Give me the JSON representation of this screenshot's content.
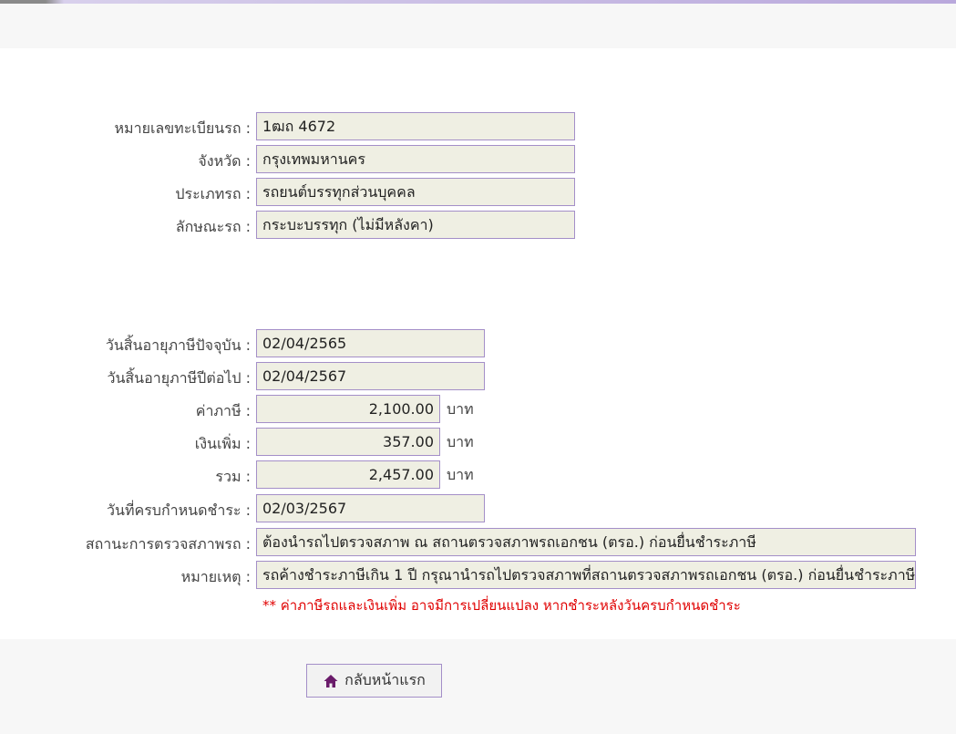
{
  "vehicle": {
    "plate_label": "หมายเลขทะเบียนรถ :",
    "plate_value": "1ฒถ 4672",
    "province_label": "จังหวัด :",
    "province_value": "กรุงเทพมหานคร",
    "type_label": "ประเภทรถ :",
    "type_value": "รถยนต์บรรทุกส่วนบุคคล",
    "body_label": "ลักษณะรถ :",
    "body_value": "กระบะบรรทุก (ไม่มีหลังคา)"
  },
  "tax": {
    "current_expiry_label": "วันสิ้นอายุภาษีปัจจุบัน :",
    "current_expiry_value": "02/04/2565",
    "next_expiry_label": "วันสิ้นอายุภาษีปีต่อไป :",
    "next_expiry_value": "02/04/2567",
    "tax_label": "ค่าภาษี :",
    "tax_value": "2,100.00",
    "surcharge_label": "เงินเพิ่ม :",
    "surcharge_value": "357.00",
    "total_label": "รวม :",
    "total_value": "2,457.00",
    "unit": "บาท",
    "due_date_label": "วันที่ครบกำหนดชำระ :",
    "due_date_value": "02/03/2567",
    "inspection_label": "สถานะการตรวจสภาพรถ :",
    "inspection_value": "ต้องนำรถไปตรวจสภาพ ณ สถานตรวจสภาพรถเอกชน (ตรอ.) ก่อนยื่นชำระภาษี",
    "remark_label": "หมายเหตุ :",
    "remark_value": "รถค้างชำระภาษีเกิน 1 ปี กรุณานำรถไปตรวจสภาพที่สถานตรวจสภาพรถเอกชน (ตรอ.) ก่อนยื่นชำระภาษี",
    "notice": "** ค่าภาษีรถและเงินเพิ่ม อาจมีการเปลี่ยนแปลง หากชำระหลังวันครบกำหนดชำระ"
  },
  "actions": {
    "home_label": "กลับหน้าแรก",
    "home_icon": "home-icon"
  },
  "colors": {
    "field_border": "#a48fc8",
    "field_bg": "#efefe3",
    "notice": "#e00000",
    "icon": "#6a1b6a"
  }
}
